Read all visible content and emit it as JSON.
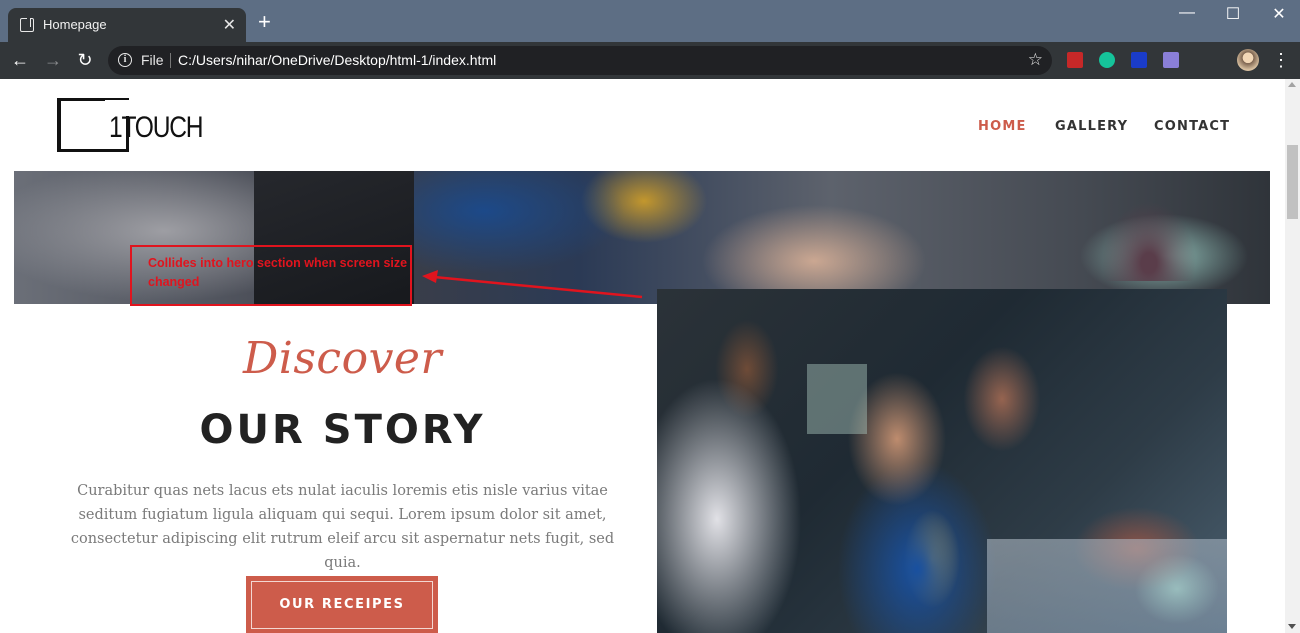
{
  "browser": {
    "tab_title": "Homepage",
    "tab_close": "✕",
    "new_tab": "+",
    "window": {
      "minimize": "—",
      "maximize": "☐",
      "close": "✕"
    },
    "nav": {
      "back": "←",
      "forward": "→",
      "reload": "↻"
    },
    "omnibox": {
      "scheme_label": "File",
      "url": "C:/Users/nihar/OneDrive/Desktop/html-1/index.html"
    },
    "menu": "⋮",
    "extension_colors": [
      "#c62828",
      "#15c39a",
      "#1a3cc8",
      "#8a7fd8"
    ]
  },
  "site": {
    "logo_text": "1TOUCH",
    "nav": [
      {
        "label": "HOME",
        "active": true
      },
      {
        "label": "GALLERY",
        "active": false
      },
      {
        "label": "CONTACT",
        "active": false
      }
    ],
    "annotation": "Collides into hero section when screen size changed",
    "story": {
      "script_title": "Discover",
      "title": "OUR STORY",
      "paragraph": "Curabitur quas nets lacus ets nulat iaculis loremis etis nisle varius vitae seditum fugiatum ligula aliquam qui sequi. Lorem ipsum dolor sit amet, consectetur adipiscing elit rutrum eleif arcu sit aspernatur nets fugit, sed quia.",
      "button": "OUR RECEIPES"
    },
    "colors": {
      "accent": "#cd5c4b",
      "annotation": "#e0141e"
    }
  }
}
